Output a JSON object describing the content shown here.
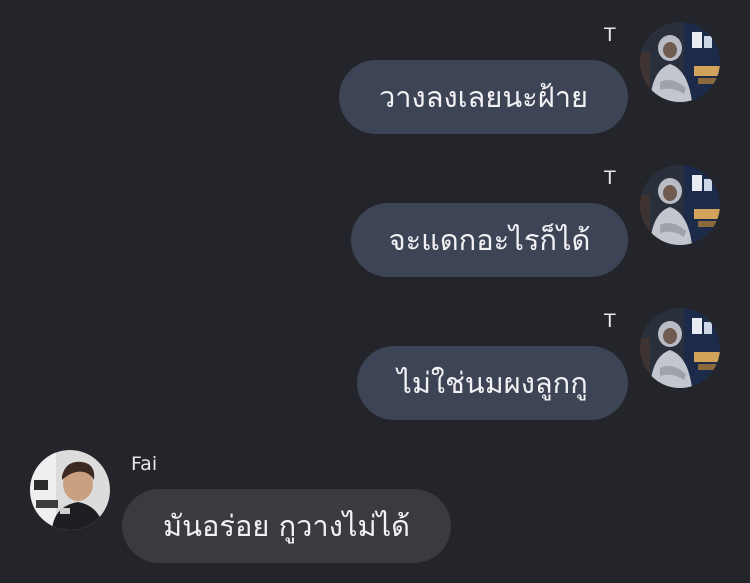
{
  "messages": [
    {
      "sender": "T",
      "direction": "outgoing",
      "text": "วางลงเลยนะฝ้าย"
    },
    {
      "sender": "T",
      "direction": "outgoing",
      "text": "จะแดกอะไรก็ได้"
    },
    {
      "sender": "T",
      "direction": "outgoing",
      "text": "ไม่ใช่นมผงลูกกู"
    },
    {
      "sender": "Fai",
      "direction": "incoming",
      "text": "มันอร่อย กูวางไม่ได้"
    }
  ],
  "colors": {
    "background": "#24252a",
    "outgoing_bubble": "#3d4456",
    "incoming_bubble": "#3a3b41",
    "text": "#f2f2f4"
  },
  "icons": {
    "t_avatar": "avatar-photo-hooded-person",
    "fai_avatar": "avatar-photo-person"
  }
}
